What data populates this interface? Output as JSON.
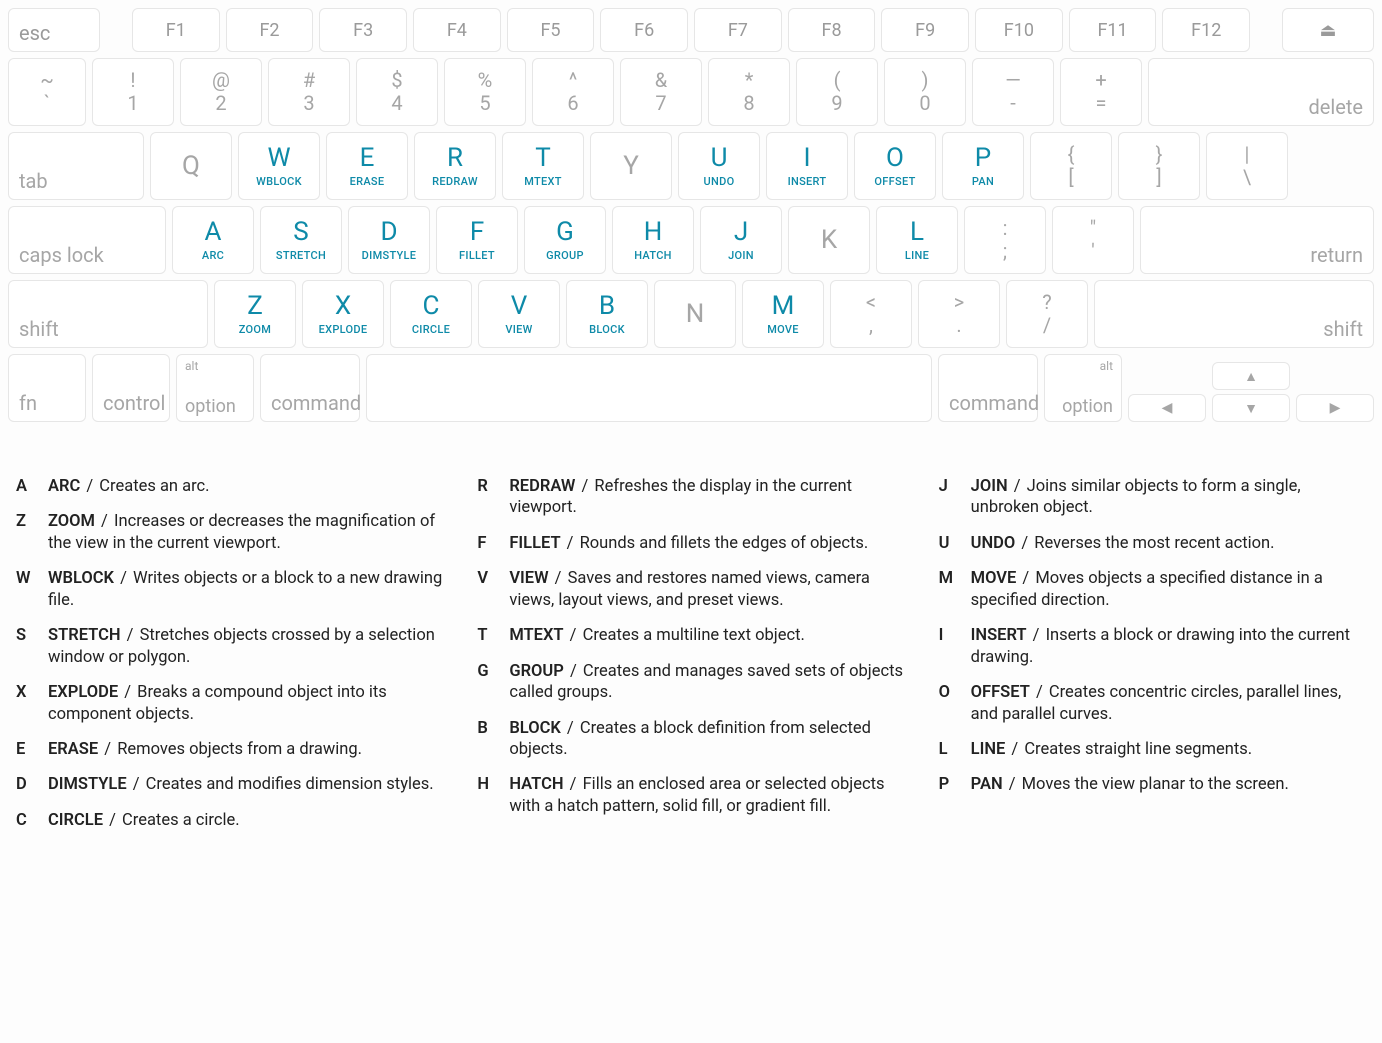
{
  "row_func": {
    "esc": "esc",
    "keys": [
      "F1",
      "F2",
      "F3",
      "F4",
      "F5",
      "F6",
      "F7",
      "F8",
      "F9",
      "F10",
      "F11",
      "F12"
    ],
    "eject": "⏏"
  },
  "row_num": {
    "tilde": {
      "top": "~",
      "bot": "`"
    },
    "pairs": [
      {
        "top": "!",
        "bot": "1"
      },
      {
        "top": "@",
        "bot": "2"
      },
      {
        "top": "#",
        "bot": "3"
      },
      {
        "top": "$",
        "bot": "4"
      },
      {
        "top": "%",
        "bot": "5"
      },
      {
        "top": "^",
        "bot": "6"
      },
      {
        "top": "&",
        "bot": "7"
      },
      {
        "top": "*",
        "bot": "8"
      },
      {
        "top": "(",
        "bot": "9"
      },
      {
        "top": ")",
        "bot": "0"
      },
      {
        "top": "—",
        "bot": "-"
      },
      {
        "top": "+",
        "bot": "="
      }
    ],
    "delete": "delete"
  },
  "row_q": {
    "tab": "tab",
    "keys": [
      {
        "k": "Q",
        "hl": false,
        "sub": ""
      },
      {
        "k": "W",
        "hl": true,
        "sub": "WBLOCK"
      },
      {
        "k": "E",
        "hl": true,
        "sub": "ERASE"
      },
      {
        "k": "R",
        "hl": true,
        "sub": "REDRAW"
      },
      {
        "k": "T",
        "hl": true,
        "sub": "MTEXT"
      },
      {
        "k": "Y",
        "hl": false,
        "sub": ""
      },
      {
        "k": "U",
        "hl": true,
        "sub": "UNDO"
      },
      {
        "k": "I",
        "hl": true,
        "sub": "INSERT"
      },
      {
        "k": "O",
        "hl": true,
        "sub": "OFFSET"
      },
      {
        "k": "P",
        "hl": true,
        "sub": "PAN"
      }
    ],
    "brackets": [
      {
        "top": "{",
        "bot": "["
      },
      {
        "top": "}",
        "bot": "]"
      },
      {
        "top": "|",
        "bot": "\\"
      }
    ]
  },
  "row_a": {
    "caps": "caps lock",
    "keys": [
      {
        "k": "A",
        "hl": true,
        "sub": "ARC"
      },
      {
        "k": "S",
        "hl": true,
        "sub": "STRETCH"
      },
      {
        "k": "D",
        "hl": true,
        "sub": "DIMSTYLE"
      },
      {
        "k": "F",
        "hl": true,
        "sub": "FILLET"
      },
      {
        "k": "G",
        "hl": true,
        "sub": "GROUP"
      },
      {
        "k": "H",
        "hl": true,
        "sub": "HATCH"
      },
      {
        "k": "J",
        "hl": true,
        "sub": "JOIN"
      },
      {
        "k": "K",
        "hl": false,
        "sub": ""
      },
      {
        "k": "L",
        "hl": true,
        "sub": "LINE"
      }
    ],
    "punct": [
      {
        "top": ":",
        "bot": ";"
      },
      {
        "top": "\"",
        "bot": "'"
      }
    ],
    "return": "return"
  },
  "row_z": {
    "shiftL": "shift",
    "keys": [
      {
        "k": "Z",
        "hl": true,
        "sub": "ZOOM"
      },
      {
        "k": "X",
        "hl": true,
        "sub": "EXPLODE"
      },
      {
        "k": "C",
        "hl": true,
        "sub": "CIRCLE"
      },
      {
        "k": "V",
        "hl": true,
        "sub": "VIEW"
      },
      {
        "k": "B",
        "hl": true,
        "sub": "BLOCK"
      },
      {
        "k": "N",
        "hl": false,
        "sub": ""
      },
      {
        "k": "M",
        "hl": true,
        "sub": "MOVE"
      }
    ],
    "punct": [
      {
        "top": "<",
        "bot": ","
      },
      {
        "top": ">",
        "bot": "."
      },
      {
        "top": "?",
        "bot": "/"
      }
    ],
    "shiftR": "shift"
  },
  "row_mod": {
    "fn": "fn",
    "control": "control",
    "alt": "alt",
    "option": "option",
    "command": "command",
    "arrows": {
      "up": "▲",
      "down": "▼",
      "left": "◀",
      "right": "▶"
    }
  },
  "legend": {
    "col1": [
      {
        "k": "A",
        "cmd": "ARC",
        "desc": "Creates an arc."
      },
      {
        "k": "Z",
        "cmd": "ZOOM",
        "desc": "Increases or decreases the magnification of the view in the current viewport."
      },
      {
        "k": "W",
        "cmd": "WBLOCK",
        "desc": "Writes objects or a block to a new drawing file."
      },
      {
        "k": "S",
        "cmd": "STRETCH",
        "desc": "Stretches objects crossed by a selection window or polygon."
      },
      {
        "k": "X",
        "cmd": "EXPLODE",
        "desc": "Breaks a compound object into its component objects."
      },
      {
        "k": "E",
        "cmd": "ERASE",
        "desc": "Removes objects from a drawing."
      },
      {
        "k": "D",
        "cmd": "DIMSTYLE",
        "desc": "Creates and modifies dimension styles."
      },
      {
        "k": "C",
        "cmd": "CIRCLE",
        "desc": "Creates a circle."
      }
    ],
    "col2": [
      {
        "k": "R",
        "cmd": "REDRAW",
        "desc": "Refreshes the display in the current viewport."
      },
      {
        "k": "F",
        "cmd": "FILLET",
        "desc": "Rounds and fillets the edges of objects."
      },
      {
        "k": "V",
        "cmd": "VIEW",
        "desc": "Saves and restores named views, camera views, layout views, and preset views."
      },
      {
        "k": "T",
        "cmd": "MTEXT",
        "desc": "Creates a multiline text object."
      },
      {
        "k": "G",
        "cmd": "GROUP",
        "desc": "Creates and manages saved sets of objects called groups."
      },
      {
        "k": "B",
        "cmd": "BLOCK",
        "desc": "Creates a block definition from selected objects."
      },
      {
        "k": "H",
        "cmd": "HATCH",
        "desc": "Fills an enclosed area or selected objects with a hatch pattern, solid fill, or gradient fill."
      }
    ],
    "col3": [
      {
        "k": "J",
        "cmd": "JOIN",
        "desc": "Joins similar objects to form a single, unbroken object."
      },
      {
        "k": "U",
        "cmd": "UNDO",
        "desc": "Reverses the most recent action."
      },
      {
        "k": "M",
        "cmd": "MOVE",
        "desc": "Moves objects a specified distance in a specified direction."
      },
      {
        "k": "I",
        "cmd": "INSERT",
        "desc": "Inserts a block or drawing into the current drawing."
      },
      {
        "k": "O",
        "cmd": "OFFSET",
        "desc": "Creates concentric circles, parallel lines, and parallel curves."
      },
      {
        "k": "L",
        "cmd": "LINE",
        "desc": "Creates straight line segments."
      },
      {
        "k": "P",
        "cmd": "PAN",
        "desc": "Moves the view planar to the screen."
      }
    ]
  }
}
